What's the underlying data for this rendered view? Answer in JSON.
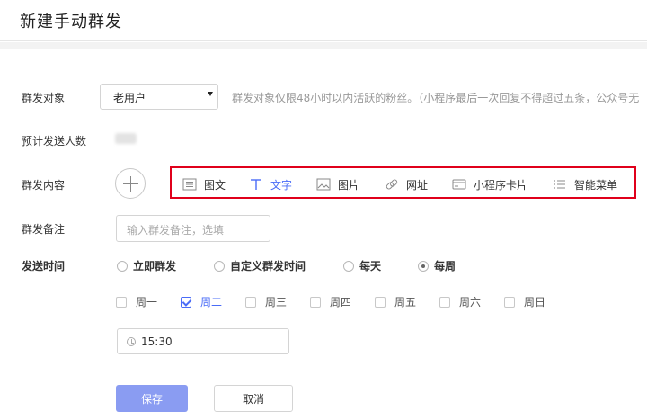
{
  "page_title": "新建手动群发",
  "fields": {
    "target_label": "群发对象",
    "target_value": "老用户",
    "target_hint": "群发对象仅限48小时以内活跃的粉丝。（小程序最后一次回复不得超过五条，公众号无",
    "estimate_label": "预计发送人数",
    "content_label": "群发内容",
    "remark_label": "群发备注",
    "remark_placeholder": "输入群发备注，选填",
    "send_time_label": "发送时间"
  },
  "content_types": [
    {
      "label": "图文",
      "icon": "news-icon"
    },
    {
      "label": "文字",
      "icon": "text-icon",
      "active": true
    },
    {
      "label": "图片",
      "icon": "image-icon"
    },
    {
      "label": "网址",
      "icon": "link-icon"
    },
    {
      "label": "小程序卡片",
      "icon": "miniprogram-card-icon"
    },
    {
      "label": "智能菜单",
      "icon": "menu-list-icon"
    }
  ],
  "send_modes": [
    {
      "label": "立即群发",
      "selected": false
    },
    {
      "label": "自定义群发时间",
      "selected": false
    },
    {
      "label": "每天",
      "selected": false
    },
    {
      "label": "每周",
      "selected": true
    }
  ],
  "weekdays": [
    {
      "label": "周一",
      "checked": false
    },
    {
      "label": "周二",
      "checked": true
    },
    {
      "label": "周三",
      "checked": false
    },
    {
      "label": "周四",
      "checked": false
    },
    {
      "label": "周五",
      "checked": false
    },
    {
      "label": "周六",
      "checked": false
    },
    {
      "label": "周日",
      "checked": false
    }
  ],
  "time_value": "15:30",
  "buttons": {
    "save": "保存",
    "cancel": "取消"
  },
  "colors": {
    "accent": "#4a6cf7",
    "save_button": "#8a9cf2",
    "highlight_border": "#e0001b"
  }
}
